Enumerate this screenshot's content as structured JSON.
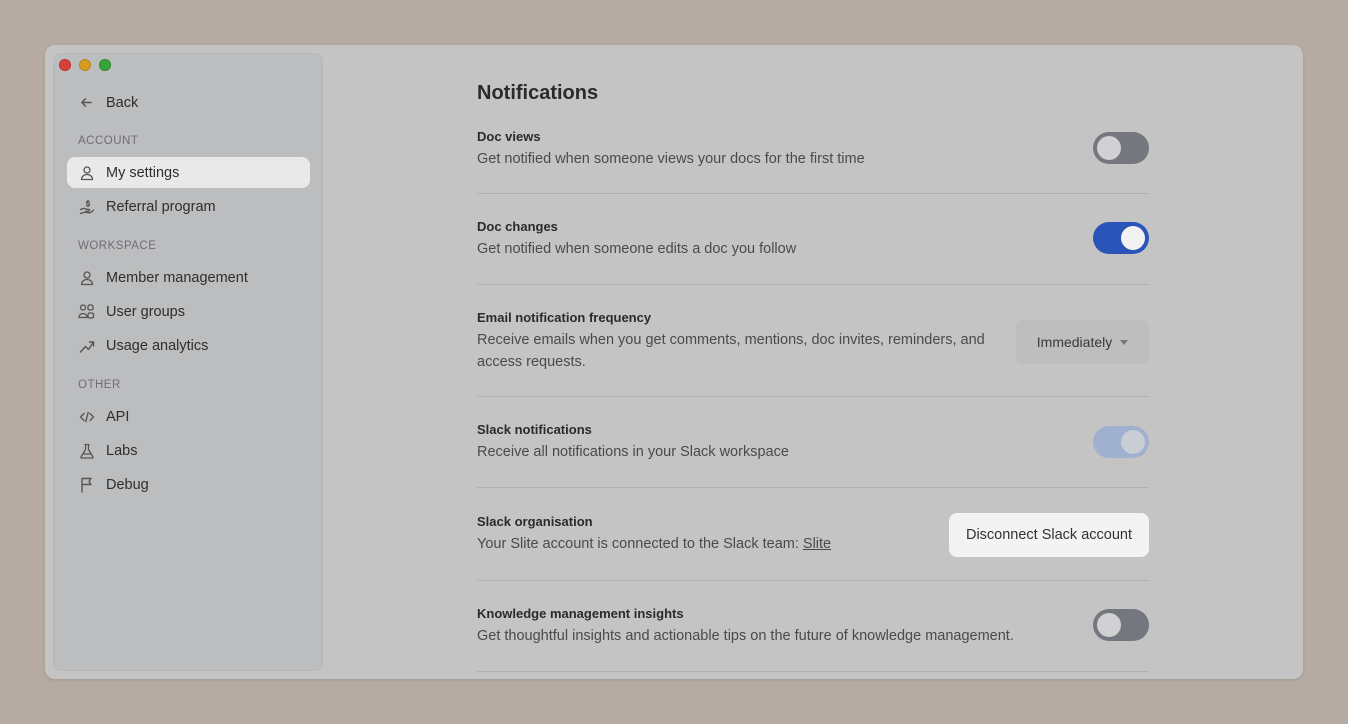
{
  "sidebar": {
    "back_label": "Back",
    "sections": [
      {
        "label": "ACCOUNT"
      },
      {
        "label": "WORKSPACE"
      },
      {
        "label": "OTHER"
      }
    ],
    "items": [
      {
        "label": "My settings",
        "icon": "user-icon",
        "active": true
      },
      {
        "label": "Referral program",
        "icon": "hand-coin-icon"
      },
      {
        "label": "Member management",
        "icon": "user-icon"
      },
      {
        "label": "User groups",
        "icon": "users-group-icon"
      },
      {
        "label": "Usage analytics",
        "icon": "trend-up-icon"
      },
      {
        "label": "API",
        "icon": "code-icon"
      },
      {
        "label": "Labs",
        "icon": "flask-icon"
      },
      {
        "label": "Debug",
        "icon": "flag-icon"
      }
    ]
  },
  "main": {
    "title": "Notifications",
    "settings": [
      {
        "title": "Doc views",
        "description": "Get notified when someone views your docs for the first time",
        "control": "toggle",
        "state": "off"
      },
      {
        "title": "Doc changes",
        "description": "Get notified when someone edits a doc you follow",
        "control": "toggle",
        "state": "on"
      },
      {
        "title": "Email notification frequency",
        "description": "Receive emails when you get comments, mentions, doc invites, reminders, and access requests.",
        "control": "select",
        "value": "Immediately"
      },
      {
        "title": "Slack notifications",
        "description": "Receive all notifications in your Slack workspace",
        "control": "toggle",
        "state": "on-disabled"
      },
      {
        "title": "Slack organisation",
        "description": "Your Slite account is connected to the Slack team:",
        "link": "Slite",
        "control": "button",
        "button_label": "Disconnect Slack account"
      },
      {
        "title": "Knowledge management insights",
        "description": "Get thoughtful insights and actionable tips on the future of knowledge management.",
        "control": "toggle",
        "state": "off"
      }
    ]
  },
  "colors": {
    "toggle_on": "#2a54b8",
    "toggle_off": "#74777e",
    "toggle_disabled": "#9fb1cf"
  }
}
